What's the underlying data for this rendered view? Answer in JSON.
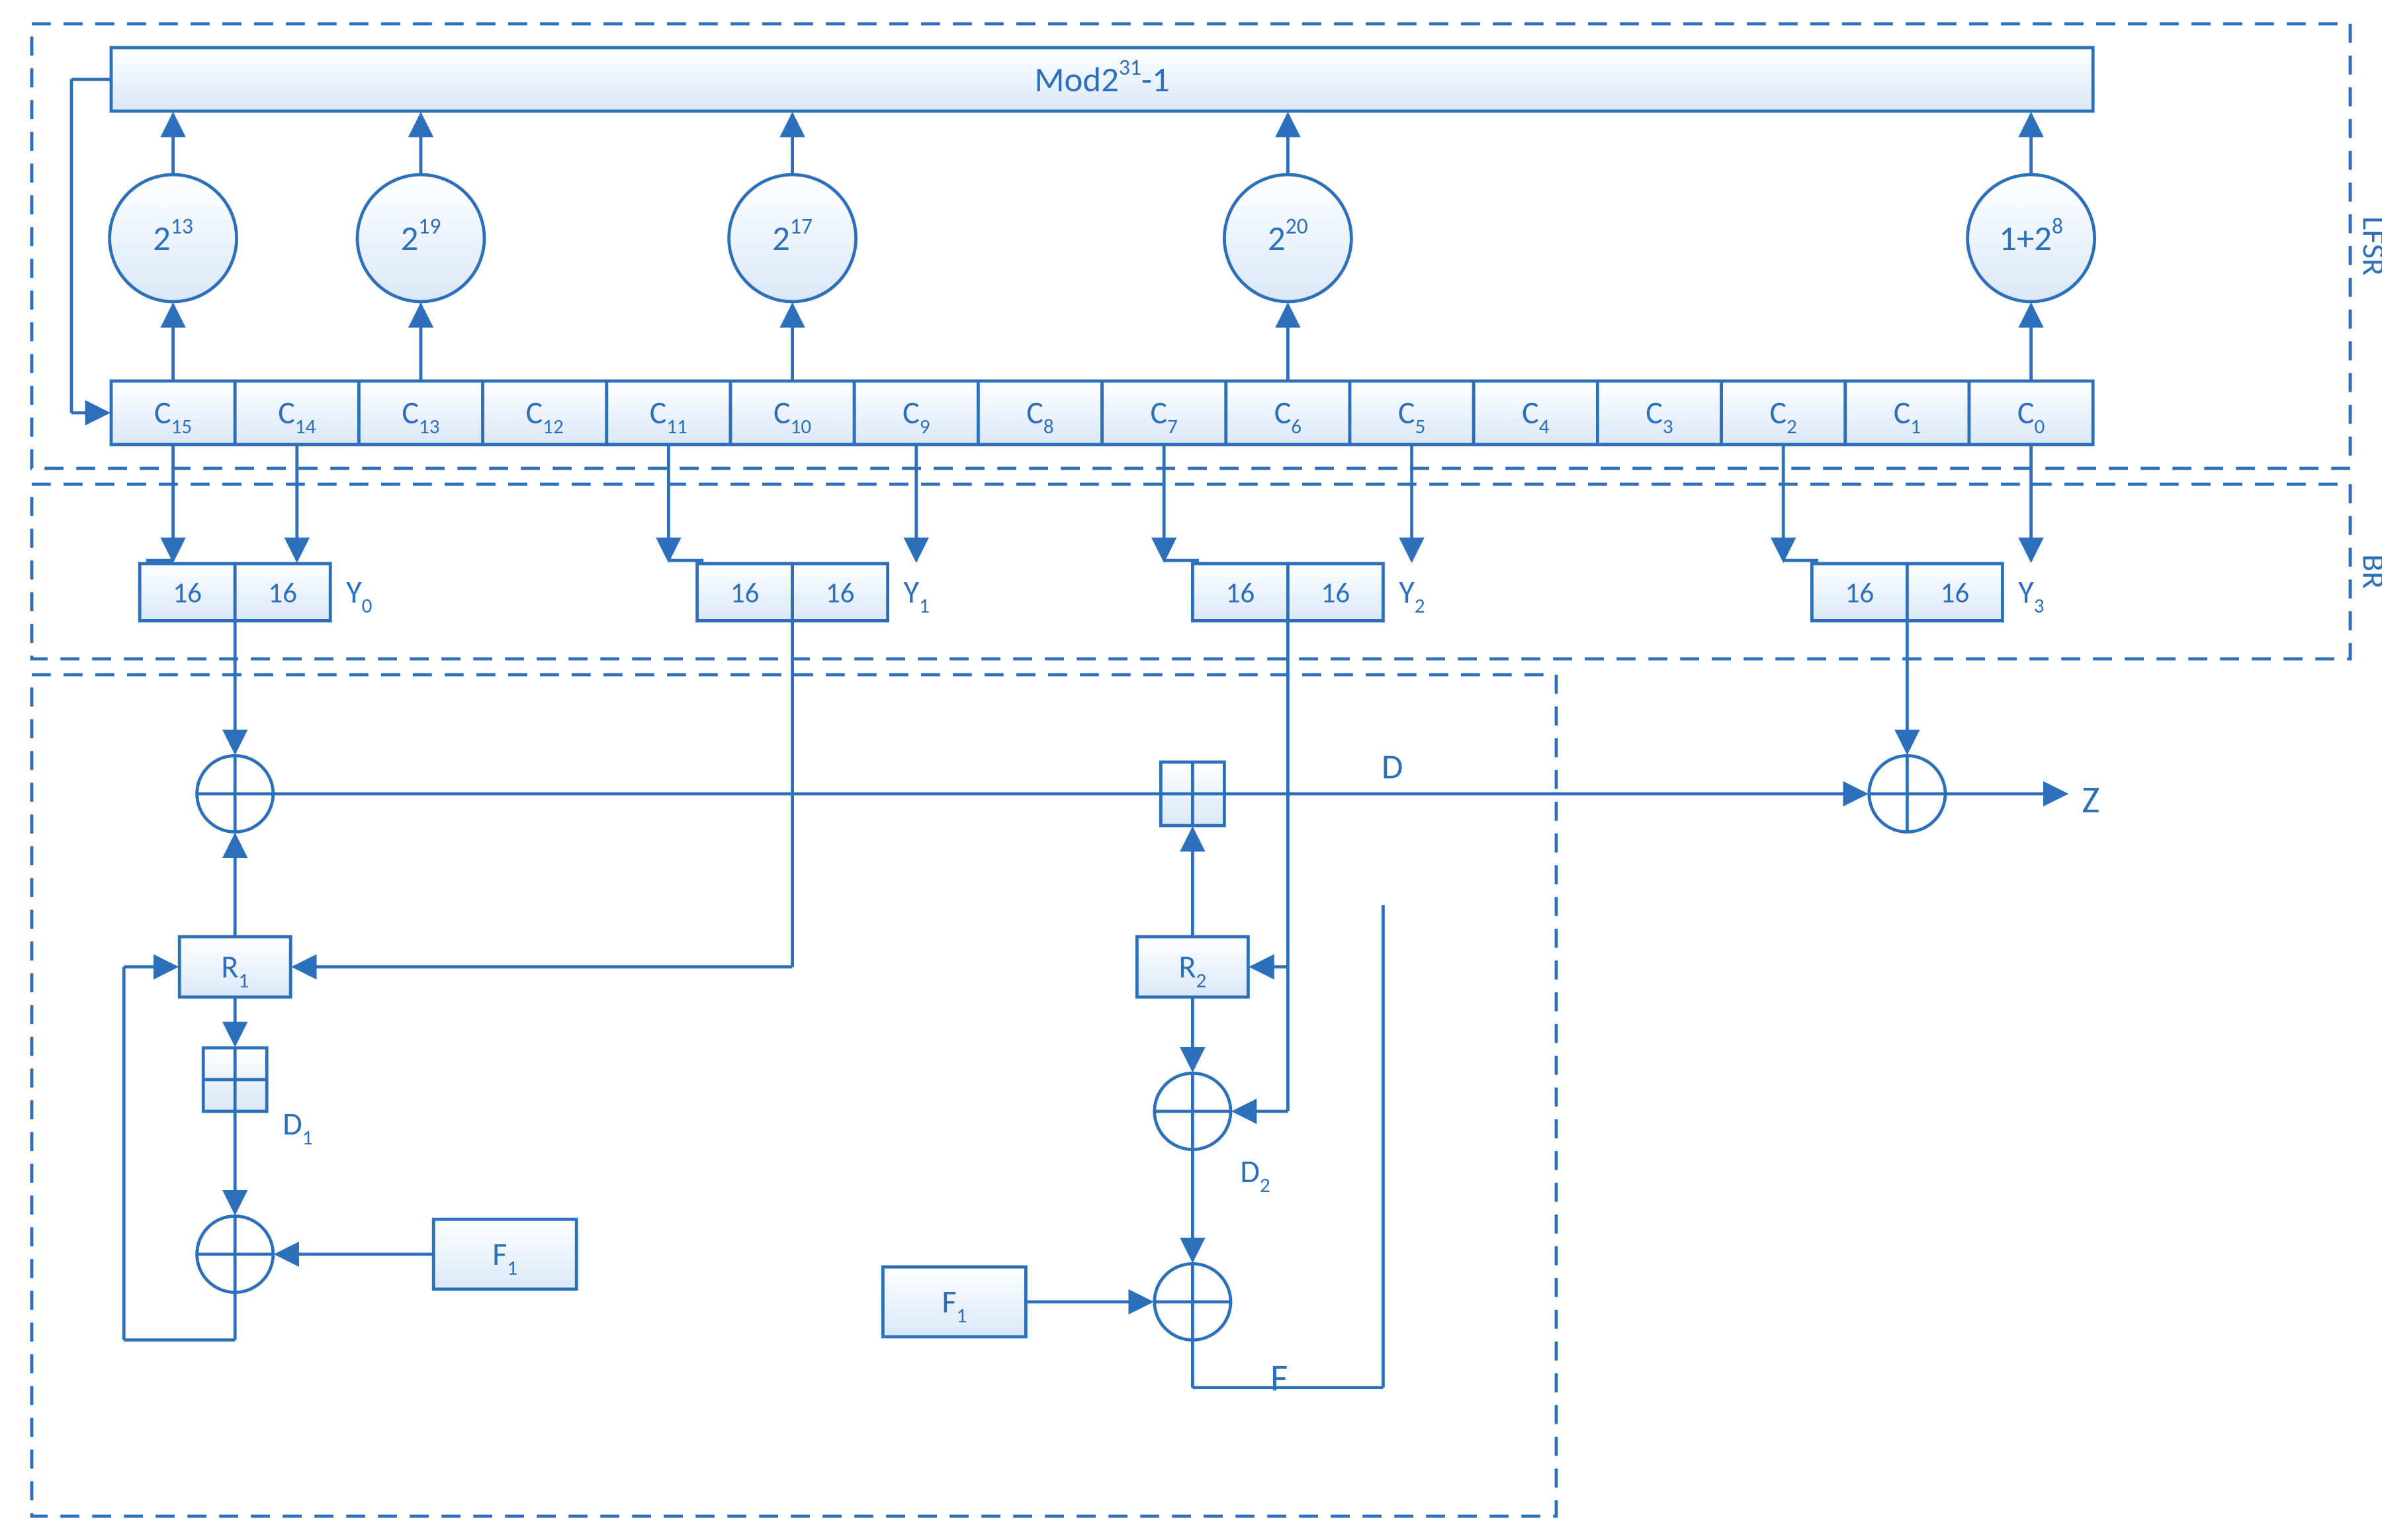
{
  "lfsr": {
    "section_label": "LFSR",
    "mod_label_base": "Mod2",
    "mod_label_exp": "31",
    "mod_label_tail": "-1",
    "mults": [
      {
        "cell": 15,
        "base": "2",
        "exp": "13"
      },
      {
        "cell": 13,
        "base": "2",
        "exp": "19"
      },
      {
        "cell": 10,
        "base": "2",
        "exp": "17"
      },
      {
        "cell": 6,
        "base": "2",
        "exp": "20"
      },
      {
        "cell": 0,
        "base": "1+2",
        "exp": "8"
      }
    ],
    "cell_prefix": "C",
    "cells": [
      "15",
      "14",
      "13",
      "12",
      "11",
      "10",
      "9",
      "8",
      "7",
      "6",
      "5",
      "4",
      "3",
      "2",
      "1",
      "0"
    ]
  },
  "br": {
    "section_label": "BR",
    "y_prefix": "Y",
    "half_label": "16",
    "taps": [
      {
        "idx": 0,
        "left_cell": 15,
        "right_cell": 14
      },
      {
        "idx": 1,
        "left_cell": 11,
        "right_cell": 9
      },
      {
        "idx": 2,
        "left_cell": 7,
        "right_cell": 5
      },
      {
        "idx": 3,
        "left_cell": 2,
        "right_cell": 0
      }
    ]
  },
  "f": {
    "section_label": "F",
    "R1": "R",
    "R1_sub": "1",
    "R2": "R",
    "R2_sub": "2",
    "D": "D",
    "D1": "D",
    "D1_sub": "1",
    "D2": "D",
    "D2_sub": "2",
    "F1": "F",
    "F1_sub": "1",
    "Z": "Z"
  }
}
